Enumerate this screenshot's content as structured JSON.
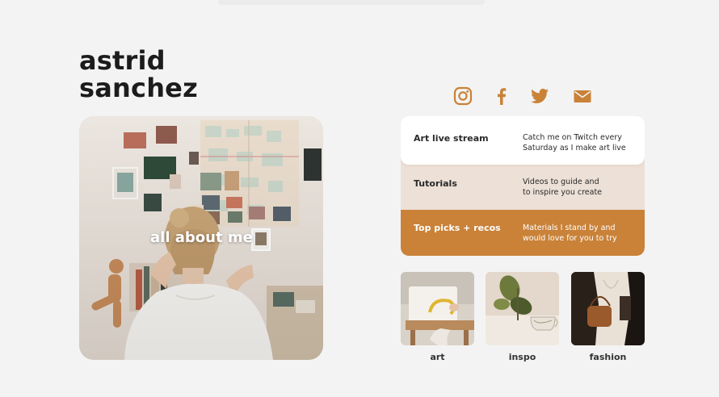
{
  "profile": {
    "first_name": "astrid",
    "last_name": "sanchez"
  },
  "hero": {
    "label": "all about me"
  },
  "socials": [
    {
      "name": "instagram-icon"
    },
    {
      "name": "facebook-icon"
    },
    {
      "name": "twitter-icon"
    },
    {
      "name": "mail-icon"
    }
  ],
  "menu": [
    {
      "label": "Art live stream",
      "description_line1": "Catch me on Twitch every",
      "description_line2": "Saturday as I make art live"
    },
    {
      "label": "Tutorials",
      "description_line1": "Videos to guide and",
      "description_line2": "to inspire you create"
    },
    {
      "label": "Top picks + recos",
      "description_line1": "Materials I stand by and",
      "description_line2": "would love for you to try"
    }
  ],
  "gallery": [
    {
      "caption": "art"
    },
    {
      "caption": "inspo"
    },
    {
      "caption": "fashion"
    }
  ],
  "colors": {
    "background": "#f3f3f3",
    "accent": "#c98238",
    "beige": "#ede0d6",
    "text": "#1c1c1c"
  }
}
